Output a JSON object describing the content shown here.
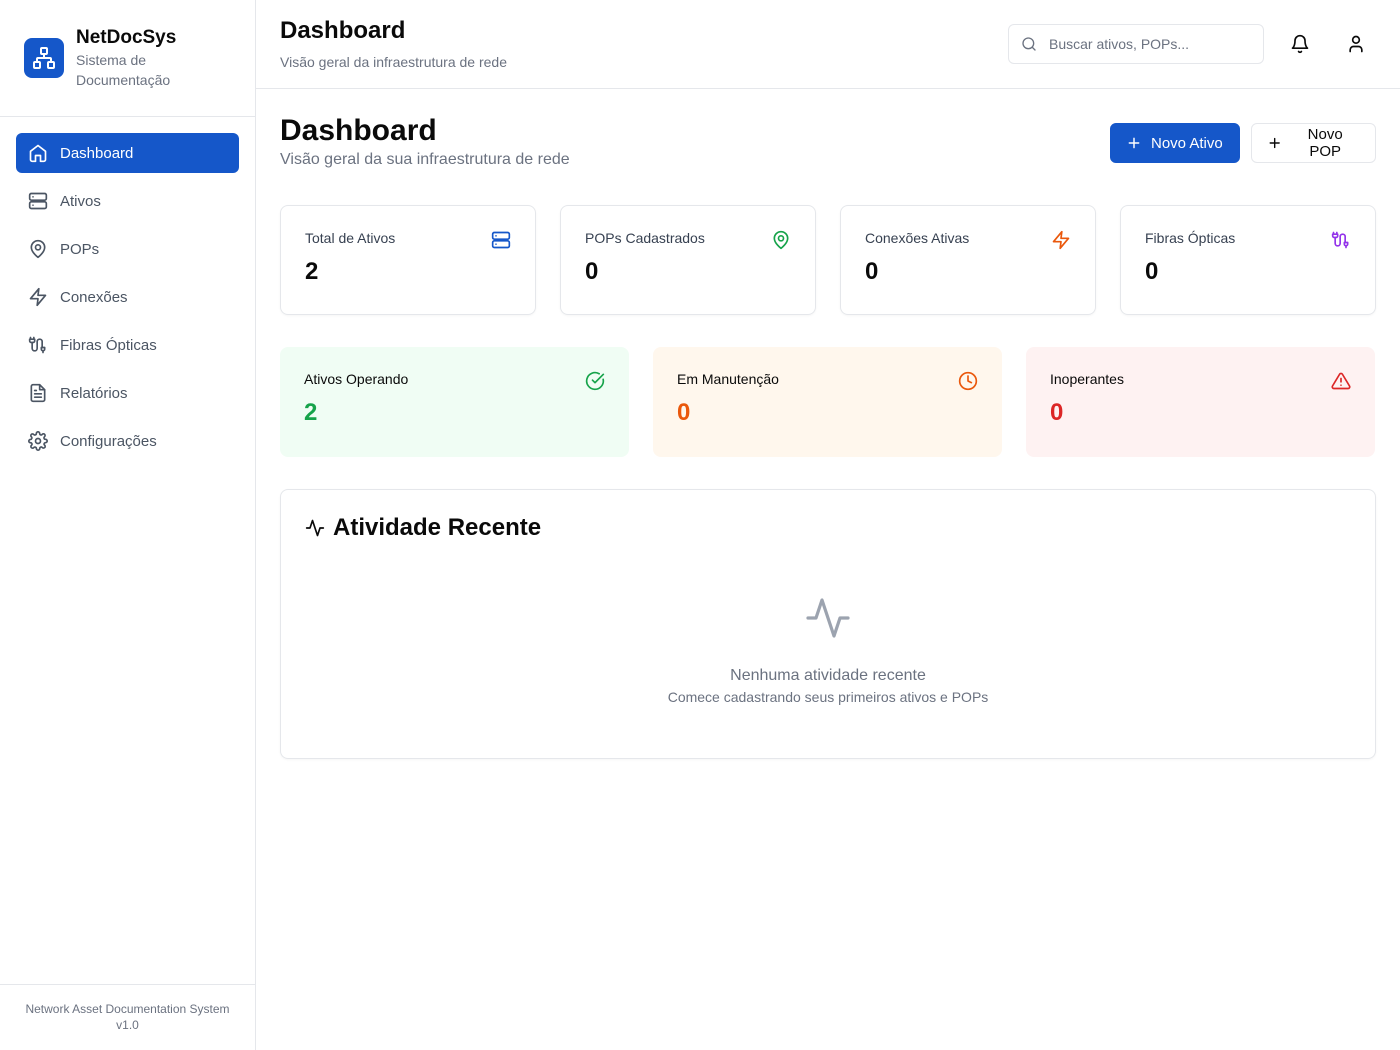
{
  "brand": {
    "name": "NetDocSys",
    "subtitle": "Sistema de Documentação",
    "color": "#1557c9"
  },
  "sidebar": {
    "items": [
      {
        "label": "Dashboard",
        "icon": "home-icon",
        "active": true
      },
      {
        "label": "Ativos",
        "icon": "server-icon"
      },
      {
        "label": "POPs",
        "icon": "map-pin-icon"
      },
      {
        "label": "Conexões",
        "icon": "zap-icon"
      },
      {
        "label": "Fibras Ópticas",
        "icon": "cable-icon"
      },
      {
        "label": "Relatórios",
        "icon": "file-text-icon"
      },
      {
        "label": "Configurações",
        "icon": "settings-icon"
      }
    ],
    "footer": {
      "line1": "Network Asset Documentation System",
      "line2": "v1.0"
    }
  },
  "header": {
    "title": "Dashboard",
    "subtitle": "Visão geral da infraestrutura de rede",
    "search_placeholder": "Buscar ativos, POPs...",
    "notifications_icon": "bell-icon",
    "user_icon": "user-icon"
  },
  "main": {
    "title": "Dashboard",
    "subtitle": "Visão geral da sua infraestrutura de rede",
    "new_asset_label": "Novo Ativo",
    "new_pop_label": "Novo POP",
    "stats": [
      {
        "label": "Total de Ativos",
        "value": "2",
        "icon": "server-icon",
        "color": "#1557c9"
      },
      {
        "label": "POPs Cadastrados",
        "value": "0",
        "icon": "map-pin-icon",
        "color": "#16a34a"
      },
      {
        "label": "Conexões Ativas",
        "value": "0",
        "icon": "zap-icon",
        "color": "#ea580c"
      },
      {
        "label": "Fibras Ópticas",
        "value": "0",
        "icon": "cable-icon",
        "color": "#9333ea"
      }
    ],
    "status": [
      {
        "label": "Ativos Operando",
        "value": "2",
        "icon": "check-circle-icon",
        "color": "#16a34a",
        "bg": "#f0fdf4"
      },
      {
        "label": "Em Manutenção",
        "value": "0",
        "icon": "clock-icon",
        "color": "#ea580c",
        "bg": "#fff7ed"
      },
      {
        "label": "Inoperantes",
        "value": "0",
        "icon": "alert-triangle-icon",
        "color": "#dc2626",
        "bg": "#fef2f2"
      }
    ],
    "activity": {
      "title": "Atividade Recente",
      "icon": "activity-icon",
      "empty_title": "Nenhuma atividade recente",
      "empty_subtitle": "Comece cadastrando seus primeiros ativos e POPs"
    }
  }
}
